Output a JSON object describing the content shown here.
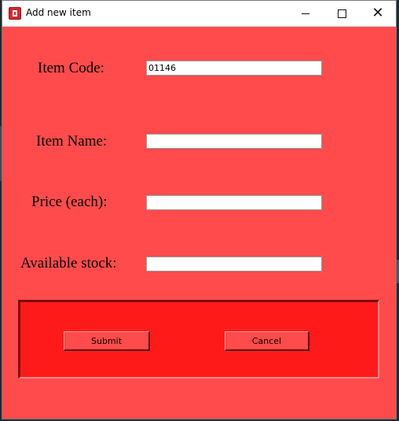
{
  "window": {
    "title": "Add new item",
    "icon": "app-window-icon",
    "controls": {
      "minimize_icon": "minimize-icon",
      "maximize_icon": "maximize-icon",
      "close_glyph": "✕"
    },
    "background_color": "#ff4b4b"
  },
  "form": {
    "item_code": {
      "label": "Item Code:",
      "value": "01146",
      "placeholder": ""
    },
    "item_name": {
      "label": "Item Name:",
      "value": "",
      "placeholder": ""
    },
    "price": {
      "label": "Price (each):",
      "value": "",
      "placeholder": ""
    },
    "stock": {
      "label": "Available stock:",
      "value": "",
      "placeholder": ""
    }
  },
  "actions": {
    "submit_label": "Submit",
    "cancel_label": "Cancel",
    "frame_color": "#ff1a1a"
  }
}
